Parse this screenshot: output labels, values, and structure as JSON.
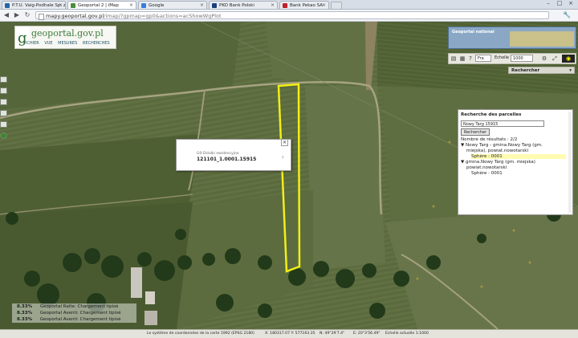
{
  "browser": {
    "tabs": [
      {
        "title": "P.T.U. Vaig-Podhale Sp. z",
        "favicon_color": "#2a64a8",
        "active": false
      },
      {
        "title": "Geoportal 2 | iMap",
        "favicon_color": "#4c8c3a",
        "active": true
      },
      {
        "title": "Google",
        "favicon_color": "#3a7be0",
        "active": false
      },
      {
        "title": "PKO Bank Polski",
        "favicon_color": "#1a3f7a",
        "active": false
      },
      {
        "title": "Bank Pekao SA",
        "favicon_color": "#c0202a",
        "active": false
      }
    ],
    "address_host": "mapy.geoportal.gov.pl",
    "address_path": "/imap/?gpmap=gp0&actions=acShowWgPlot"
  },
  "geoportal": {
    "brand_text": "geoportal.gov.pl",
    "brand_prefix": "g",
    "menu": [
      "FICHIER",
      "VUE",
      "MESURES",
      "RECHERCHES"
    ],
    "national_label": "Geoportal national",
    "language": "Fra",
    "scale_label": "Echelle",
    "scale_value": "1000",
    "search_panel_title": "Rechercher"
  },
  "parcel_search": {
    "title": "Recherche des parcelles",
    "query": "Nowy Targ 15915",
    "button": "Rechercher",
    "results_count": "Nombre de résultats : 2/2",
    "result1_line1": "▼ Nowy Targ - gmina.Nowy Targ (gm.",
    "result1_line2": "miejska), powiat.nowotarski",
    "result1_sphere": "Sphère : 0001",
    "result2_line1": "▼ gmina.Nowy Targ (gm. miejska)",
    "result2_line2": "powiat.nowotarski",
    "result2_sphere": "Sphère : 0001"
  },
  "popup": {
    "subtitle": "G0-Dzialki ewidencyjne",
    "parcel_id": "121101_1.0001.15915"
  },
  "loading": [
    {
      "pct": "8.33%",
      "text": "Geoportal Ralte: Chargement tipisé"
    },
    {
      "pct": "8.33%",
      "text": "Geoportal Aventi: Chargement tipisé"
    },
    {
      "pct": "8.33%",
      "text": "Geoportal Aventi: Chargement tipisé"
    }
  ],
  "status": {
    "crs": "Le système de coordonnées de la carte 1992 (EPSG 2180)",
    "xy": "X: 180317.07  Y: 577163.35",
    "lat": "N: 49°29'7.4\"",
    "lon": "E: 20°3'56.49\"",
    "scale": "Echelle actuelle 1:1000"
  },
  "colors": {
    "parcel_outline": "#f2ef16",
    "field_green": "#5c6b3e"
  }
}
